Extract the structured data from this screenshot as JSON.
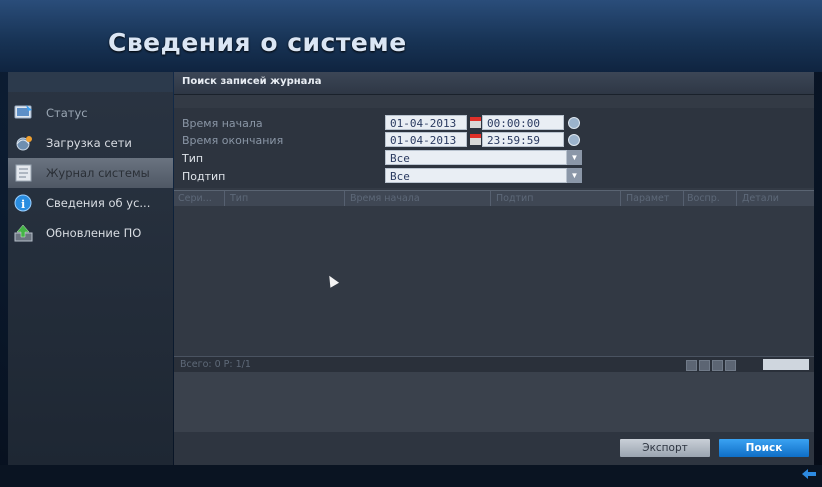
{
  "window": {
    "title": "Сведения о системе"
  },
  "sidebar": {
    "items": [
      {
        "label": "Статус",
        "icon": "monitor-icon"
      },
      {
        "label": "Загрузка сети",
        "icon": "network-icon"
      },
      {
        "label": "Журнал системы",
        "icon": "log-icon",
        "active": true
      },
      {
        "label": "Сведения об ус...",
        "icon": "info-icon"
      },
      {
        "label": "Обновление ПО",
        "icon": "upgrade-icon"
      }
    ]
  },
  "main": {
    "heading": "Поиск записей журнала",
    "form": {
      "start_label": "Время начала",
      "start_date": "01-04-2013",
      "start_time": "00:00:00",
      "end_label": "Время окончания",
      "end_date": "01-04-2013",
      "end_time": "23:59:59",
      "type_label": "Тип",
      "type_value": "Все",
      "subtype_label": "Подтип",
      "subtype_value": "Все"
    },
    "table": {
      "columns": [
        "Сери...",
        "Тип",
        "Время начала",
        "Подтип",
        "Парамет",
        "Воспр.",
        "Детали"
      ],
      "footer": "Всего: 0 P: 1/1"
    },
    "buttons": {
      "export": "Экспорт",
      "search": "Поиск"
    }
  },
  "colors": {
    "accent": "#1f86e0",
    "header": "#1e3a5f"
  }
}
